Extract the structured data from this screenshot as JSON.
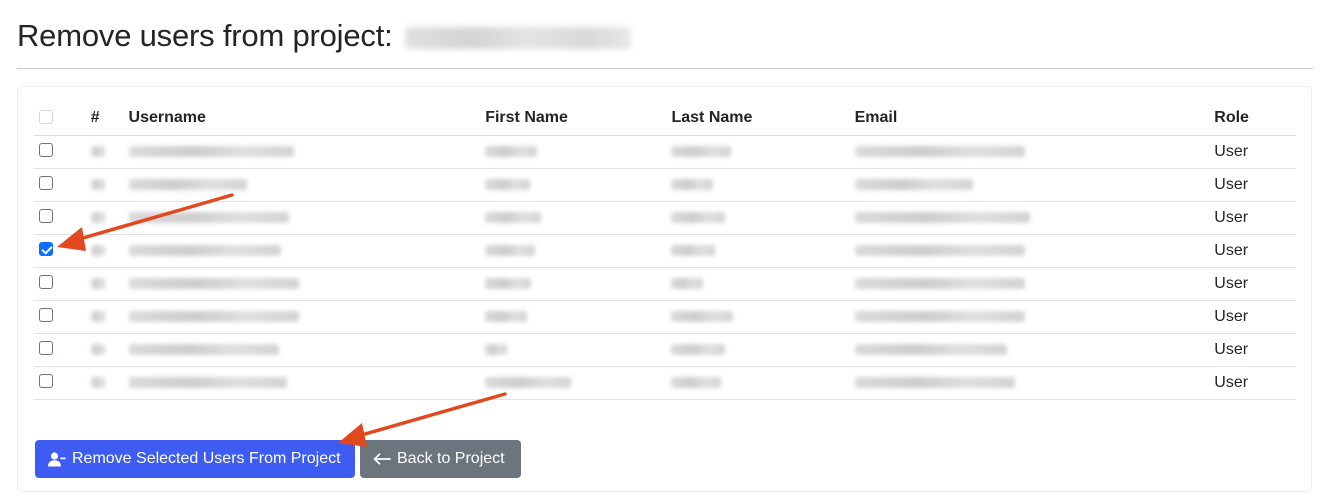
{
  "page": {
    "title": "Remove users from project:"
  },
  "table": {
    "columns": [
      "#",
      "Username",
      "First Name",
      "Last Name",
      "Email",
      "Role"
    ],
    "rows": [
      {
        "role": "User",
        "checked": false,
        "blur": {
          "num": 14,
          "user": 165,
          "first": 52,
          "last": 60,
          "email": 170
        }
      },
      {
        "role": "User",
        "checked": false,
        "blur": {
          "num": 14,
          "user": 118,
          "first": 45,
          "last": 42,
          "email": 118
        }
      },
      {
        "role": "User",
        "checked": false,
        "blur": {
          "num": 14,
          "user": 160,
          "first": 56,
          "last": 54,
          "email": 175
        }
      },
      {
        "role": "User",
        "checked": true,
        "blur": {
          "num": 14,
          "user": 152,
          "first": 50,
          "last": 44,
          "email": 170
        }
      },
      {
        "role": "User",
        "checked": false,
        "blur": {
          "num": 14,
          "user": 170,
          "first": 46,
          "last": 32,
          "email": 170
        }
      },
      {
        "role": "User",
        "checked": false,
        "blur": {
          "num": 14,
          "user": 170,
          "first": 42,
          "last": 62,
          "email": 170
        }
      },
      {
        "role": "User",
        "checked": false,
        "blur": {
          "num": 14,
          "user": 150,
          "first": 22,
          "last": 54,
          "email": 152
        }
      },
      {
        "role": "User",
        "checked": false,
        "blur": {
          "num": 14,
          "user": 158,
          "first": 86,
          "last": 50,
          "email": 160
        }
      }
    ]
  },
  "actions": {
    "remove_label": "Remove Selected Users From Project",
    "back_label": "Back to Project"
  },
  "colors": {
    "primary": "#3d5df2",
    "secondary": "#6c757d",
    "annotation_arrow": "#e2481e"
  }
}
